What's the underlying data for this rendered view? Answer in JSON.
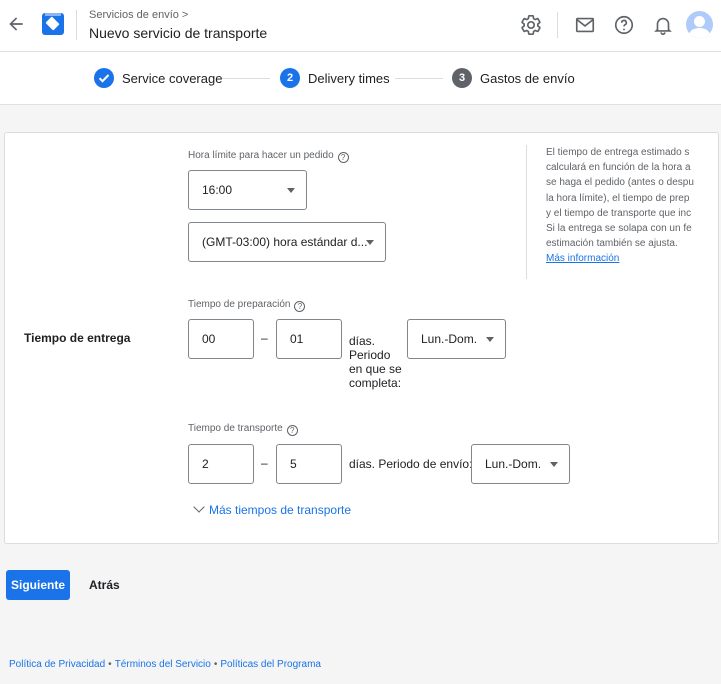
{
  "header": {
    "breadcrumb": "Servicios de envío",
    "title": "Nuevo servicio de transporte"
  },
  "stepper": {
    "steps": [
      {
        "label": "Service coverage",
        "state": "completed",
        "number": ""
      },
      {
        "label": "Delivery times",
        "state": "active",
        "number": "2"
      },
      {
        "label": "Gastos de envío",
        "state": "pending",
        "number": "3"
      }
    ]
  },
  "colors": {
    "accent": "#1a73e8",
    "pending": "#5f6368"
  },
  "form": {
    "section_title": "Tiempo de entrega",
    "cutoff": {
      "label": "Hora límite para hacer un pedido",
      "time_value": "16:00",
      "timezone_value": "(GMT-03:00) hora estándar d..."
    },
    "prep": {
      "label": "Tiempo de preparación",
      "min": "00",
      "max": "01",
      "suffix_lines": [
        "días.",
        "Periodo",
        "en que se",
        "completa:"
      ],
      "days_value": "Lun.-Dom."
    },
    "transit": {
      "label": "Tiempo de transporte",
      "min": "2",
      "max": "5",
      "suffix": "días. Periodo de envío:",
      "days_value": "Lun.-Dom."
    },
    "dash": "–",
    "more_link": "Más tiempos de transporte"
  },
  "help": {
    "lines": [
      "El tiempo de entrega estimado s",
      "calculará en función de la hora a",
      "se haga el pedido (antes o despu",
      "la hora límite), el tiempo de prep",
      "y el tiempo de transporte que inc",
      "Si la entrega se solapa con un fe",
      "estimación también se ajusta."
    ],
    "link": "Más información"
  },
  "actions": {
    "next": "Siguiente",
    "back": "Atrás"
  },
  "footer": {
    "links": [
      "Política de Privacidad",
      "Términos del Servicio",
      "Políticas del Programa"
    ],
    "separator": "•"
  }
}
